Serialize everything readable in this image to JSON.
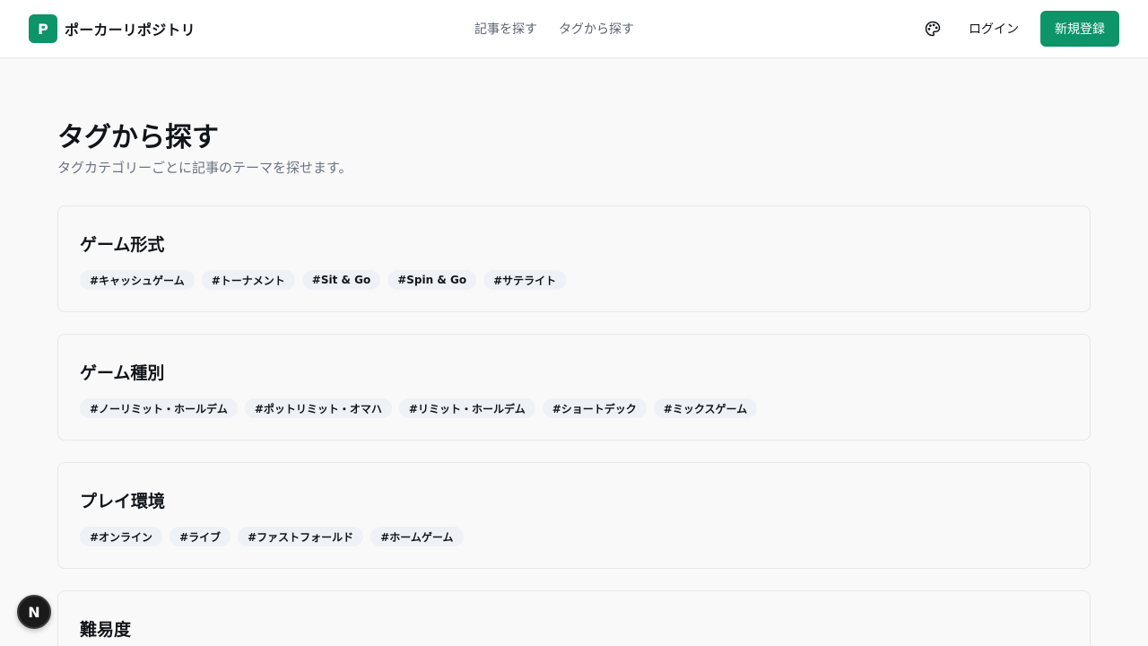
{
  "header": {
    "logo_letter": "P",
    "site_name": "ポーカーリポジトリ",
    "nav": [
      {
        "label": "記事を探す"
      },
      {
        "label": "タグから探す"
      }
    ],
    "theme_icon": "palette-icon",
    "login_label": "ログイン",
    "signup_label": "新規登録"
  },
  "page": {
    "title": "タグから探す",
    "subtitle": "タグカテゴリーごとに記事のテーマを探せます。"
  },
  "sections": [
    {
      "title": "ゲーム形式",
      "tags": [
        "#キャッシュゲーム",
        "#トーナメント",
        "#Sit & Go",
        "#Spin & Go",
        "#サテライト"
      ]
    },
    {
      "title": "ゲーム種別",
      "tags": [
        "#ノーリミット・ホールデム",
        "#ポットリミット・オマハ",
        "#リミット・ホールデム",
        "#ショートデック",
        "#ミックスゲーム"
      ]
    },
    {
      "title": "プレイ環境",
      "tags": [
        "#オンライン",
        "#ライブ",
        "#ファストフォールド",
        "#ホームゲーム"
      ]
    },
    {
      "title": "難易度",
      "tags": []
    }
  ],
  "fab": {
    "label": "N",
    "icon": "nextjs-icon"
  },
  "colors": {
    "accent": "#0d9468",
    "background": "#f9f9fa",
    "tag_bg": "#eef1f5",
    "muted_text": "#6b7380"
  }
}
